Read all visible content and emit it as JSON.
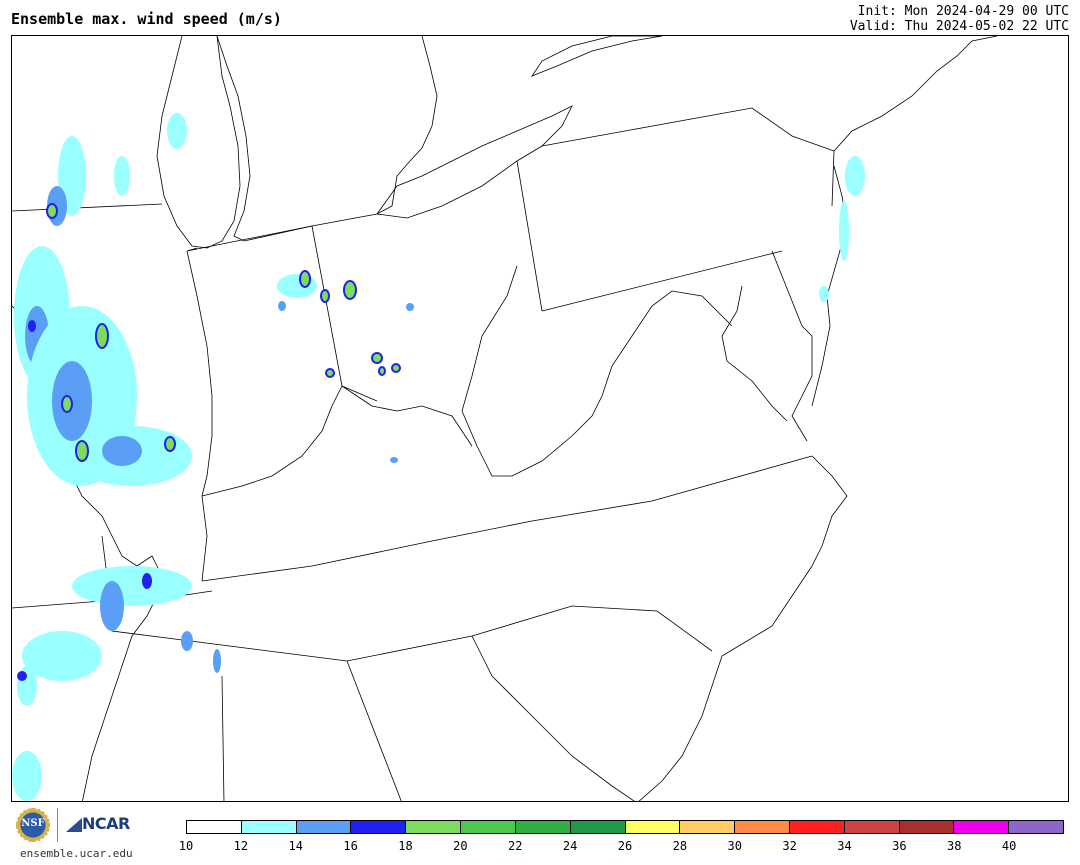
{
  "header": {
    "title": "Ensemble max. wind speed (m/s)",
    "init": "Init: Mon 2024-04-29 00 UTC",
    "valid": "Valid: Thu 2024-05-02 22 UTC"
  },
  "footer": {
    "site": "ensemble.ucar.edu",
    "nsf_logo_text": "NSF",
    "ncar_logo_text": "NCAR"
  },
  "colorbar": {
    "colors": [
      "#ffffff",
      "#99ffff",
      "#5a9ef5",
      "#2020f0",
      "#7cdc5c",
      "#4cc84c",
      "#30b040",
      "#229944",
      "#ffff66",
      "#ffcc66",
      "#ff8c44",
      "#ff2020",
      "#cc4444",
      "#aa3030",
      "#ee00ee",
      "#8c66cc"
    ],
    "tick_labels": [
      "10",
      "12",
      "14",
      "16",
      "18",
      "20",
      "22",
      "24",
      "26",
      "28",
      "30",
      "32",
      "34",
      "36",
      "38",
      "40"
    ]
  }
}
